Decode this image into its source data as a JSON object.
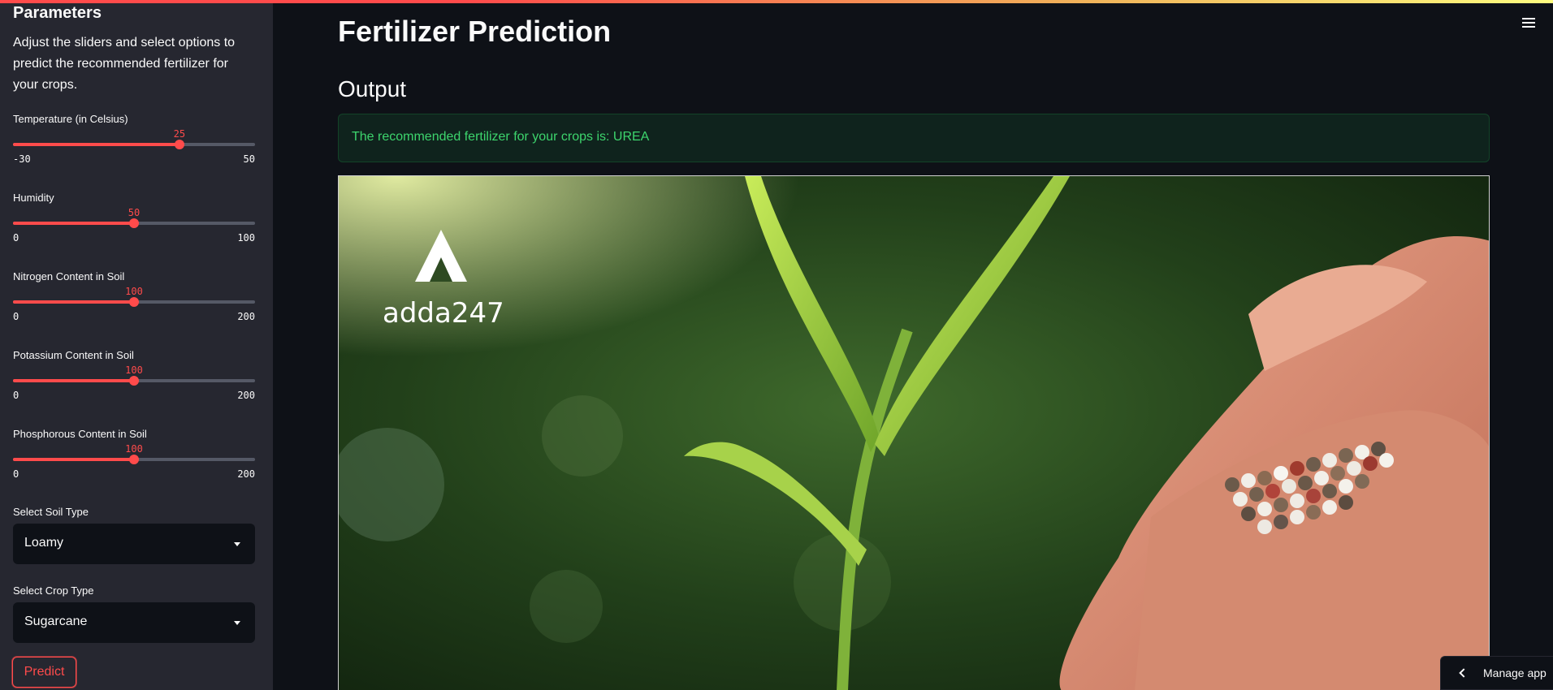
{
  "sidebar": {
    "title": "Parameters",
    "description": "Adjust the sliders and select options to predict the recommended fertilizer for your crops.",
    "sliders": [
      {
        "label": "Temperature (in Celsius)",
        "value": "25",
        "min": "-30",
        "max": "50",
        "fraction": 0.6875
      },
      {
        "label": "Humidity",
        "value": "50",
        "min": "0",
        "max": "100",
        "fraction": 0.5
      },
      {
        "label": "Nitrogen Content in Soil",
        "value": "100",
        "min": "0",
        "max": "200",
        "fraction": 0.5
      },
      {
        "label": "Potassium Content in Soil",
        "value": "100",
        "min": "0",
        "max": "200",
        "fraction": 0.5
      },
      {
        "label": "Phosphorous Content in Soil",
        "value": "100",
        "min": "0",
        "max": "200",
        "fraction": 0.5
      }
    ],
    "soil": {
      "label": "Select Soil Type",
      "value": "Loamy"
    },
    "crop": {
      "label": "Select Crop Type",
      "value": "Sugarcane"
    },
    "predict_label": "Predict"
  },
  "main": {
    "title": "Fertilizer Prediction",
    "output_heading": "Output",
    "result_text": "The recommended fertilizer for your crops is: UREA",
    "image_logo_text": "adda247",
    "menu_icon": "hamburger-icon"
  },
  "manage_app": {
    "label": "Manage app",
    "icon": "chevron-left-icon"
  },
  "colors": {
    "accent": "#ff4b4b",
    "sidebar_bg": "#262730",
    "main_bg": "#0e1117",
    "success_text": "#3dd56d"
  }
}
